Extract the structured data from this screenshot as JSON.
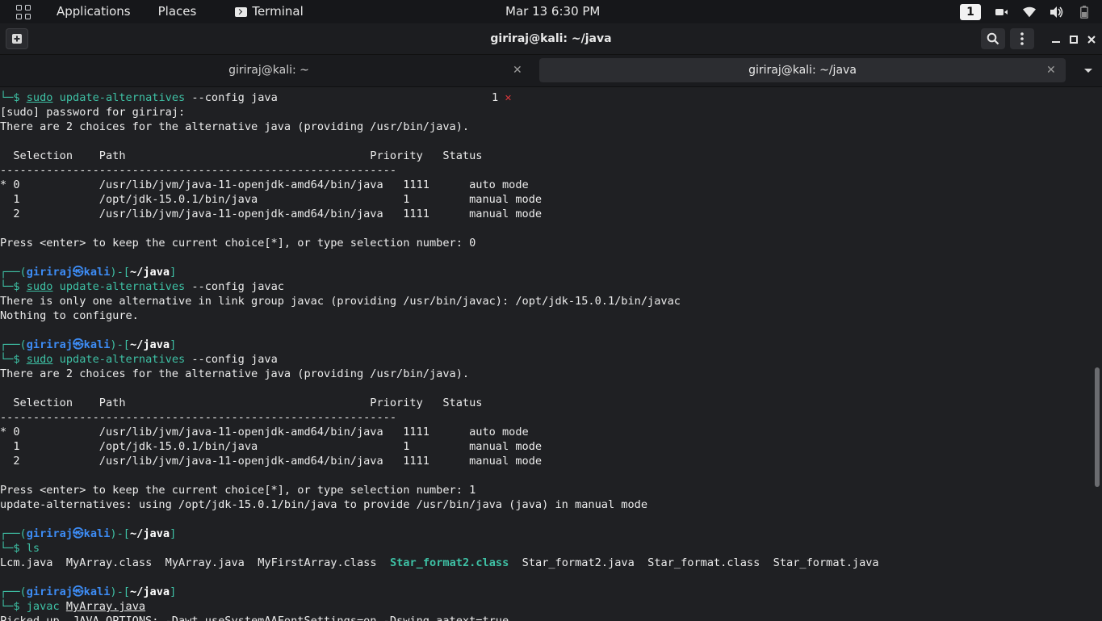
{
  "topbar": {
    "applications": "Applications",
    "places": "Places",
    "terminal": "Terminal",
    "clock": "Mar 13   6:30 PM",
    "workspace": "1"
  },
  "header": {
    "title": "giriraj@kali: ~/java"
  },
  "tabs": [
    {
      "label": "giriraj@kali: ~",
      "active": false
    },
    {
      "label": "giriraj@kali: ~/java",
      "active": true
    }
  ],
  "terminal": {
    "cmd1": {
      "sudo": "sudo",
      "rest": " update-alternatives ",
      "flag": "--config",
      "arg": " java",
      "exit_code": "1",
      "exit_mark": "✕"
    },
    "out1": "[sudo] password for giriraj:",
    "out2": "There are 2 choices for the alternative java (providing /usr/bin/java).",
    "table_header": "  Selection    Path                                     Priority   Status",
    "table_sep": "------------------------------------------------------------",
    "table1_rows": [
      "* 0            /usr/lib/jvm/java-11-openjdk-amd64/bin/java   1111      auto mode",
      "  1            /opt/jdk-15.0.1/bin/java                      1         manual mode",
      "  2            /usr/lib/jvm/java-11-openjdk-amd64/bin/java   1111      manual mode"
    ],
    "press1": "Press <enter> to keep the current choice[*], or type selection number: 0",
    "prompt": {
      "user": "giriraj",
      "at": "㉿",
      "host": "kali",
      "path": "~/java"
    },
    "cmd2": {
      "sudo": "sudo",
      "rest": " update-alternatives ",
      "flag": "--config",
      "arg": " javac"
    },
    "out3": "There is only one alternative in link group javac (providing /usr/bin/javac): /opt/jdk-15.0.1/bin/javac",
    "out4": "Nothing to configure.",
    "cmd3": {
      "sudo": "sudo",
      "rest": " update-alternatives ",
      "flag": "--config",
      "arg": " java"
    },
    "out5": "There are 2 choices for the alternative java (providing /usr/bin/java).",
    "table2_rows": [
      "* 0            /usr/lib/jvm/java-11-openjdk-amd64/bin/java   1111      auto mode",
      "  1            /opt/jdk-15.0.1/bin/java                      1         manual mode",
      "  2            /usr/lib/jvm/java-11-openjdk-amd64/bin/java   1111      manual mode"
    ],
    "press2": "Press <enter> to keep the current choice[*], or type selection number: 1",
    "out6": "update-alternatives: using /opt/jdk-15.0.1/bin/java to provide /usr/bin/java (java) in manual mode",
    "cmd4": "ls",
    "ls_files": {
      "f1": "Lcm.java",
      "f2": "MyArray.class",
      "f3": "MyArray.java",
      "f4": "MyFirstArray.class",
      "f5": "Star_format2.class",
      "f6": "Star_format2.java",
      "f7": "Star_format.class",
      "f8": "Star_format.java"
    },
    "cmd5": {
      "cmd": "javac",
      "arg": "MyArray.java"
    },
    "out7": "Picked up _JAVA_OPTIONS: -Dawt.useSystemAAFontSettings=on -Dswing.aatext=true"
  }
}
